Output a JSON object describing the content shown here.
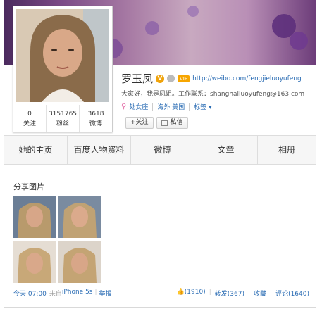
{
  "profile": {
    "name": "罗玉凤",
    "vip_label": "VIP",
    "url": "http://weibo.com/fengjieluoyufeng",
    "description": "大家好，我是凤姐。工作联系：shanghailuoyufeng@163.com",
    "tags": [
      "处女座",
      "海外 美国",
      "标签 ▾"
    ],
    "follow_label": "+关注",
    "message_label": "私信"
  },
  "stats": [
    {
      "value": "0",
      "label": "关注"
    },
    {
      "value": "3151765",
      "label": "粉丝"
    },
    {
      "value": "3618",
      "label": "微博"
    }
  ],
  "tabs": [
    "她的主页",
    "百度人物资料",
    "微博",
    "文章",
    "相册"
  ],
  "section": {
    "title": "分享图片"
  },
  "post": {
    "time": "今天 07:00",
    "source_prefix": "来自",
    "source": "iPhone 5s",
    "report": "举报",
    "like": "(1910)",
    "repost": "转发(367)",
    "favorite": "收藏",
    "comment": "评论(1640)"
  }
}
